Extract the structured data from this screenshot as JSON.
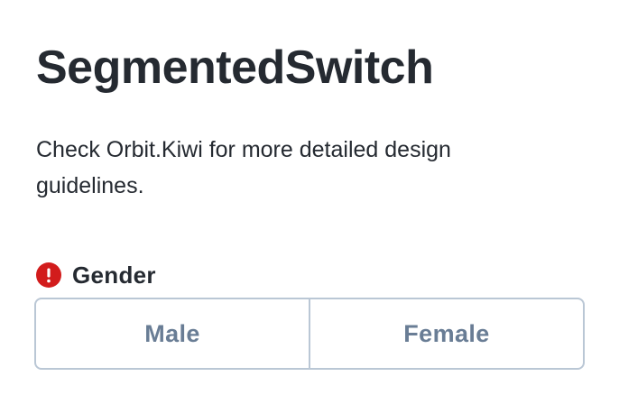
{
  "page": {
    "title": "SegmentedSwitch",
    "description": "Check Orbit.Kiwi for more detailed design guidelines."
  },
  "field": {
    "label": "Gender",
    "status_icon": "alert-circle-icon",
    "status_color": "#d21c1c",
    "options": [
      {
        "label": "Male",
        "selected": false
      },
      {
        "label": "Female",
        "selected": false
      }
    ]
  },
  "colors": {
    "text_primary": "#252a31",
    "text_secondary": "#697d95",
    "border": "#bac7d5",
    "error": "#d21c1c"
  }
}
